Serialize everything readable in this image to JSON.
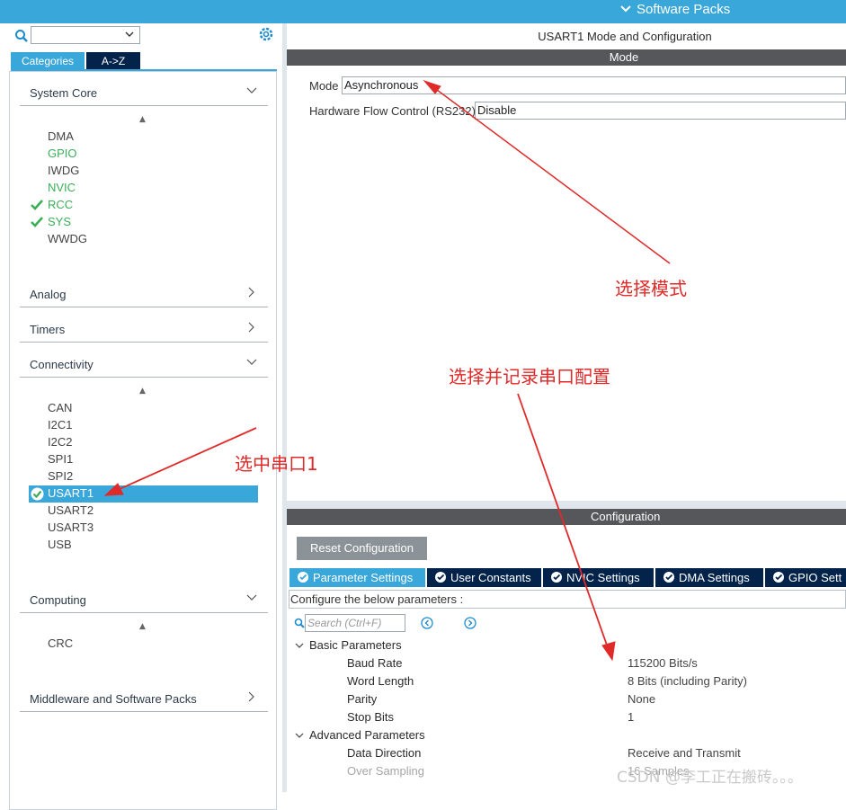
{
  "topbar": {
    "software_packs": "Software Packs"
  },
  "left": {
    "tabs": {
      "categories": "Categories",
      "az": "A->Z"
    },
    "sections": {
      "system_core": "System Core",
      "analog": "Analog",
      "timers": "Timers",
      "connectivity": "Connectivity",
      "computing": "Computing",
      "middleware": "Middleware and Software Packs"
    },
    "system_core_items": [
      "DMA",
      "GPIO",
      "IWDG",
      "NVIC",
      "RCC",
      "SYS",
      "WWDG"
    ],
    "connectivity_items": [
      "CAN",
      "I2C1",
      "I2C2",
      "SPI1",
      "SPI2",
      "USART1",
      "USART2",
      "USART3",
      "USB"
    ],
    "computing_items": [
      "CRC"
    ]
  },
  "mode": {
    "title": "USART1 Mode and Configuration",
    "header": "Mode",
    "mode_label": "Mode",
    "mode_value": "Asynchronous",
    "hw_flow_label": "Hardware Flow Control (RS232)",
    "hw_flow_value": "Disable"
  },
  "config": {
    "header": "Configuration",
    "reset_button": "Reset Configuration",
    "tabs": [
      "Parameter Settings",
      "User Constants",
      "NVIC Settings",
      "DMA Settings",
      "GPIO Sett"
    ],
    "configure_text": "Configure the below parameters :",
    "search_placeholder": "Search (Ctrl+F)",
    "basic_group": "Basic Parameters",
    "advanced_group": "Advanced Parameters",
    "params": [
      {
        "label": "Baud Rate",
        "value": "115200 Bits/s"
      },
      {
        "label": "Word Length",
        "value": "8 Bits (including Parity)"
      },
      {
        "label": "Parity",
        "value": "None"
      },
      {
        "label": "Stop Bits",
        "value": "1"
      },
      {
        "label": "Data Direction",
        "value": "Receive and Transmit"
      },
      {
        "label": "Over Sampling",
        "value": "16 Samples"
      }
    ]
  },
  "annotations": {
    "select_mode": "选择模式",
    "select_config": "选择并记录串口配置",
    "select_uart": "选中串口1"
  },
  "watermark": "CSDN @李工正在搬砖。。。",
  "colors": {
    "accent": "#3aa7da",
    "dark_tab": "#03234b",
    "header_bar": "#55575a",
    "annot_red": "#e02a2a",
    "check_green": "#3bae57"
  }
}
